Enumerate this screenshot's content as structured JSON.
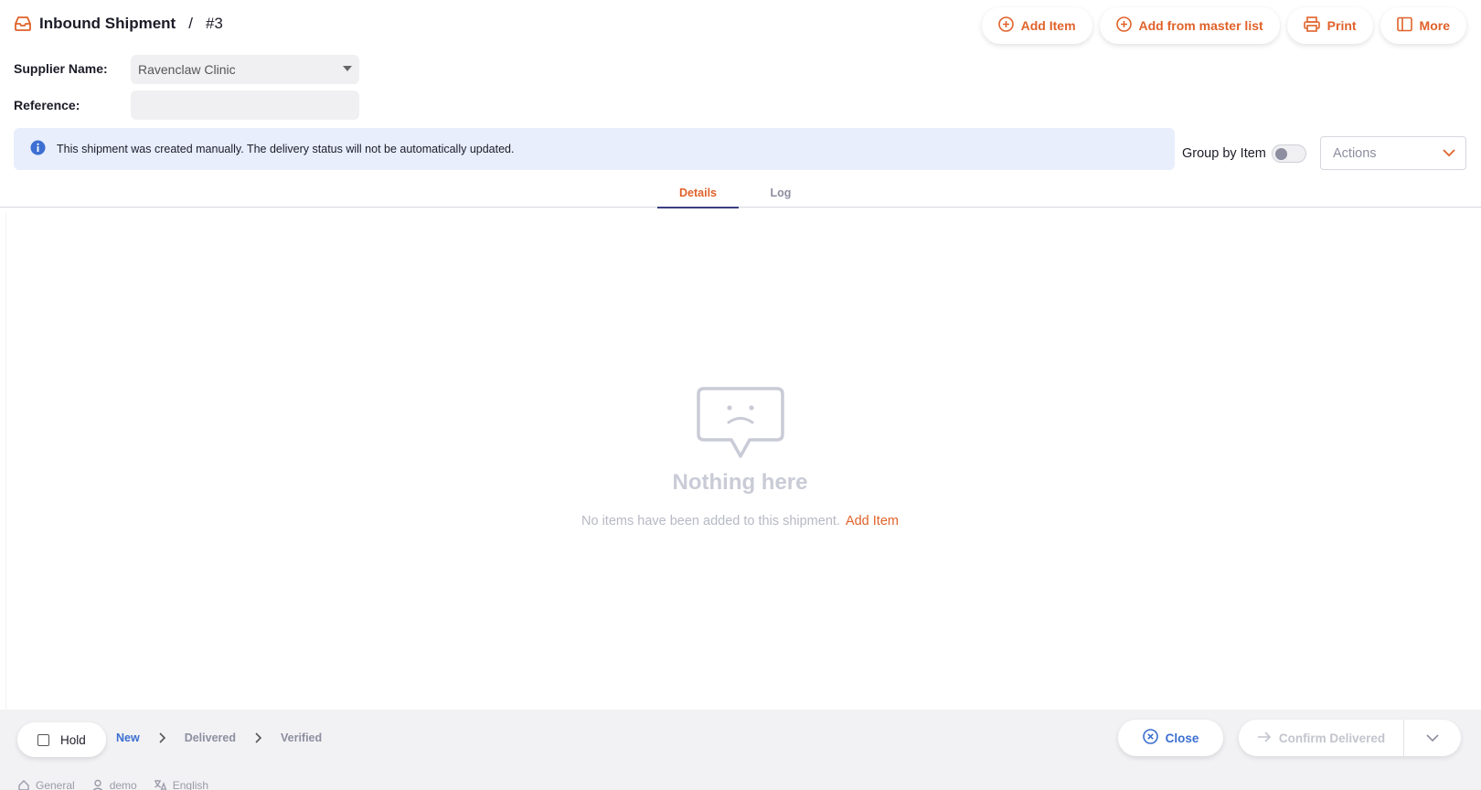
{
  "header": {
    "title": "Inbound Shipment",
    "separator": "/",
    "number": "#3"
  },
  "toolbar": {
    "add_item": "Add Item",
    "add_from_master_list": "Add from master list",
    "print": "Print",
    "more": "More"
  },
  "form": {
    "supplier_label": "Supplier Name:",
    "supplier_value": "Ravenclaw Clinic",
    "reference_label": "Reference:",
    "reference_value": ""
  },
  "info": {
    "message": "This shipment was created manually. The delivery status will not be automatically updated."
  },
  "controls": {
    "group_by_label": "Group by Item",
    "group_by_on": false,
    "actions_placeholder": "Actions"
  },
  "tabs": [
    {
      "label": "Details",
      "active": true
    },
    {
      "label": "Log",
      "active": false
    }
  ],
  "empty_state": {
    "heading": "Nothing here",
    "message": "No items have been added to this shipment.",
    "link": "Add Item"
  },
  "footer": {
    "hold_label": "Hold",
    "hold_checked": false,
    "steps": [
      "New",
      "Delivered",
      "Verified"
    ],
    "current_step": "New",
    "close_label": "Close",
    "confirm_label": "Confirm Delivered"
  },
  "status_bar": {
    "store": "General",
    "user": "demo",
    "language": "English"
  },
  "colors": {
    "accent": "#e0622a",
    "primary": "#3c6fd1",
    "info_bg": "#e8eefc",
    "muted": "#8d8ea0"
  },
  "icons": {
    "title": "inbox-icon",
    "add_item": "plus-circle-icon",
    "add_from_master_list": "plus-circle-icon",
    "print": "printer-icon",
    "more": "sidebar-panel-icon",
    "info": "info-icon",
    "empty": "sad-message-icon",
    "close": "x-circle-icon",
    "confirm": "arrow-right-icon",
    "confirm_menu": "chevron-down-icon"
  }
}
